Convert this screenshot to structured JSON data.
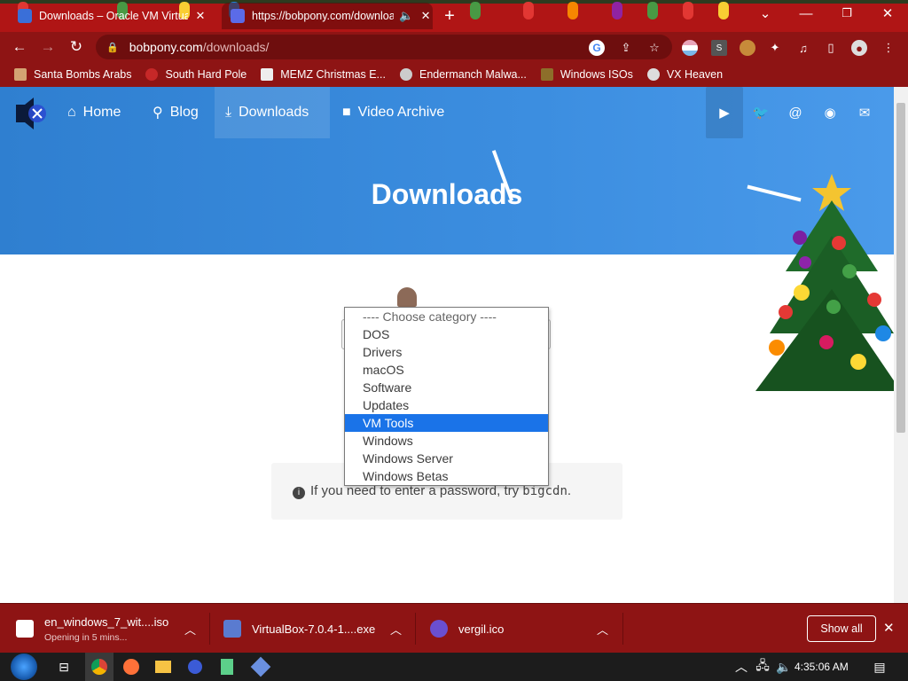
{
  "browser": {
    "tabs": [
      {
        "title": "Downloads – Oracle VM VirtualBox",
        "active": false
      },
      {
        "title": "https://bobpony.com/downloads",
        "active": true
      }
    ],
    "window_controls": {
      "minimize": "—",
      "restore": "❐",
      "close": "✕",
      "tab_search": "⌄"
    },
    "url_host": "bobpony.com",
    "url_path": "/downloads/",
    "bookmarks": [
      "Santa Bombs Arabs",
      "South Hard Pole",
      "MEMZ Christmas E...",
      "Endermanch Malwa...",
      "Windows ISOs",
      "VX Heaven"
    ]
  },
  "site": {
    "nav": [
      {
        "label": "Home",
        "icon": "home-icon",
        "glyph": "⌂"
      },
      {
        "label": "Blog",
        "icon": "blog-icon",
        "glyph": "⚲"
      },
      {
        "label": "Downloads",
        "icon": "download-icon",
        "glyph": "⤓"
      },
      {
        "label": "Video Archive",
        "icon": "video-icon",
        "glyph": "■"
      }
    ],
    "social": [
      {
        "icon": "youtube-icon",
        "glyph": "▶"
      },
      {
        "icon": "twitter-icon",
        "glyph": "🐦"
      },
      {
        "icon": "mastodon-icon",
        "glyph": "@"
      },
      {
        "icon": "github-icon",
        "glyph": "◉"
      },
      {
        "icon": "email-icon",
        "glyph": "✉"
      }
    ],
    "heading": "Downloads",
    "category_select": {
      "options": [
        "---- Choose category ----",
        "DOS",
        "Drivers",
        "macOS",
        "Software",
        "Updates",
        "VM Tools",
        "Windows",
        "Windows Server",
        "Windows Betas"
      ],
      "highlighted": "VM Tools"
    },
    "notice_prefix": "If you need to enter a password, try ",
    "notice_code": "bigcdn",
    "notice_suffix": "."
  },
  "downloads_shelf": {
    "items": [
      {
        "name": "en_windows_7_wit....iso",
        "status": "Opening in 5 mins..."
      },
      {
        "name": "VirtualBox-7.0.4-1....exe",
        "status": ""
      },
      {
        "name": "vergil.ico",
        "status": ""
      }
    ],
    "show_all": "Show all",
    "close": "✕"
  },
  "taskbar": {
    "clock": "4:35:06 AM"
  }
}
